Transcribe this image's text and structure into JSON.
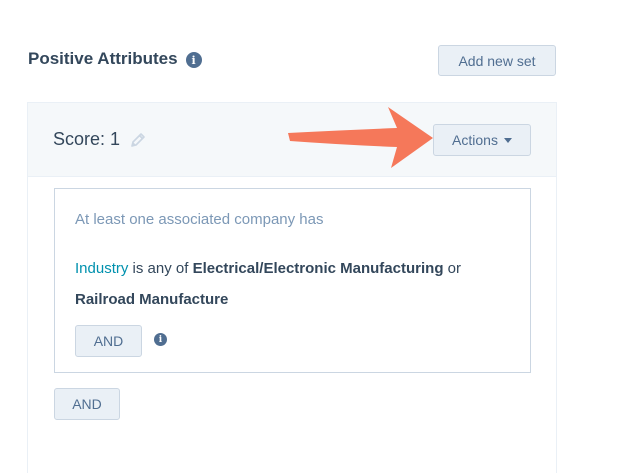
{
  "header": {
    "title": "Positive Attributes",
    "add_set_label": "Add new set"
  },
  "card": {
    "score_label": "Score: 1",
    "actions_label": "Actions",
    "filter": {
      "intro": "At least one associated company has",
      "property": "Industry",
      "operator": "is any of",
      "value_1": "Electrical/Electronic Manufacturing",
      "joiner": "or",
      "value_2": "Railroad Manufacture",
      "and_label": "AND"
    },
    "outer_and_label": "AND"
  },
  "colors": {
    "text_dark": "#33475b",
    "text_muted": "#7c98b6",
    "link": "#0091ae",
    "button_bg": "#eaf0f6",
    "arrow": "#f5785a"
  },
  "icons": {
    "info": "info-icon",
    "edit": "pencil-icon",
    "dropdown": "caret-down-icon",
    "annotation": "arrow-icon"
  }
}
